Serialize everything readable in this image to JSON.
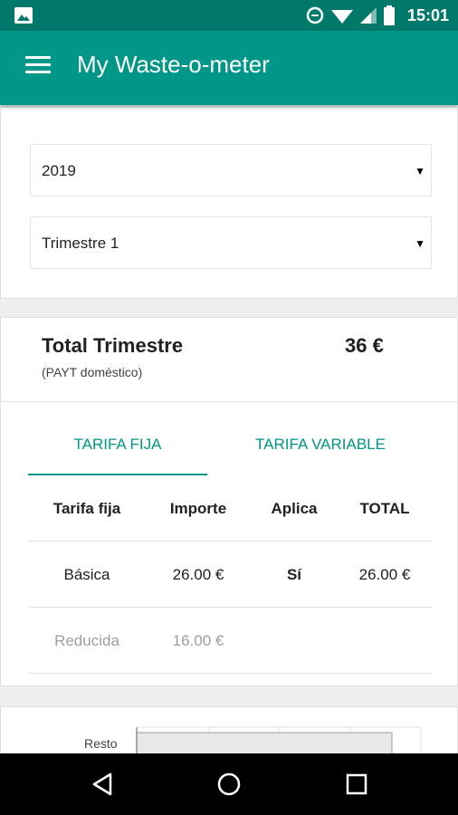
{
  "status_bar": {
    "time": "15:01",
    "icons": [
      "gallery-icon",
      "data-saver-icon",
      "wifi-icon",
      "signal-icon",
      "battery-icon"
    ]
  },
  "app_bar": {
    "title": "My Waste-o-meter",
    "icon": "menu-icon"
  },
  "filters": {
    "year": "2019",
    "quarter": "Trimestre 1"
  },
  "summary": {
    "title": "Total Trimestre",
    "subtitle": "(PAYT doméstico)",
    "amount": "36 €"
  },
  "tabs": [
    {
      "label": "TARIFA FIJA",
      "active": true
    },
    {
      "label": "TARIFA VARIABLE",
      "active": false
    }
  ],
  "table": {
    "headers": [
      "Tarifa fija",
      "Importe",
      "Aplica",
      "TOTAL"
    ],
    "rows": [
      {
        "tarifa": "Básica",
        "importe": "26.00 €",
        "aplica": "Sí",
        "total": "26.00 €",
        "disabled": false
      },
      {
        "tarifa": "Reducida",
        "importe": "16.00 €",
        "aplica": "",
        "total": "",
        "disabled": true
      }
    ]
  },
  "chart": {
    "category_label": "Resto"
  },
  "colors": {
    "primary": "#009688",
    "primary_dark": "#00796b",
    "accent_text": "#009688"
  },
  "nav_bar": {
    "icons": [
      "back-icon",
      "home-icon",
      "recents-icon"
    ]
  }
}
